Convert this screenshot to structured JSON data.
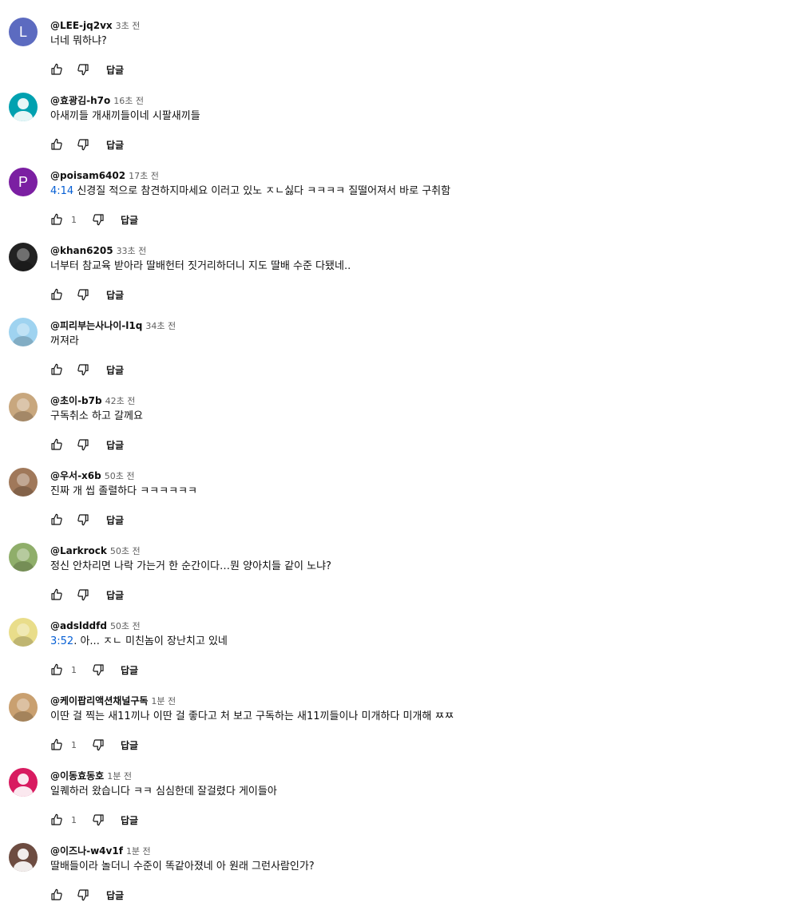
{
  "reply_label": "답글",
  "comments": [
    {
      "author": "@LEE-jq2vx",
      "time": "3초 전",
      "timestamp": "",
      "text": "너네 뭐하냐?",
      "likes": "",
      "avatar": {
        "type": "letter",
        "letter": "L",
        "color": "#5c6bc0"
      }
    },
    {
      "author": "@효광김-h7o",
      "time": "16초 전",
      "timestamp": "",
      "text": "아새끼들 개새끼들이네 시팔새끼들",
      "likes": "",
      "avatar": {
        "type": "person",
        "color": "#00a1b0"
      }
    },
    {
      "author": "@poisam6402",
      "time": "17초 전",
      "timestamp": "4:14",
      "text": " 신경질 적으로 참견하지마세요 이러고 있노 ㅈㄴ싫다 ㅋㅋㅋㅋ 질떨어져서 바로 구취함",
      "likes": "1",
      "avatar": {
        "type": "letter",
        "letter": "P",
        "color": "#7b1fa2"
      }
    },
    {
      "author": "@khan6205",
      "time": "33초 전",
      "timestamp": "",
      "text": "너부터 참교육 받아라 딸배헌터 짓거리하더니 지도 딸배 수준 다됐네..",
      "likes": "",
      "avatar": {
        "type": "photo",
        "color": "#222222"
      }
    },
    {
      "author": "@피리부는사나이-l1q",
      "time": "34초 전",
      "timestamp": "",
      "text": "꺼져라",
      "likes": "",
      "avatar": {
        "type": "photo",
        "color": "#9fd3f0"
      }
    },
    {
      "author": "@초이-b7b",
      "time": "42초 전",
      "timestamp": "",
      "text": "구독취소 하고 갈께요",
      "likes": "",
      "avatar": {
        "type": "photo",
        "color": "#c8a77e"
      }
    },
    {
      "author": "@우서-x6b",
      "time": "50초 전",
      "timestamp": "",
      "text": "진짜 개 씹 졸렬하다 ㅋㅋㅋㅋㅋㅋ",
      "likes": "",
      "avatar": {
        "type": "photo",
        "color": "#a0785a"
      }
    },
    {
      "author": "@Larkrock",
      "time": "50초 전",
      "timestamp": "",
      "text": "정신 안차리면 나락 가는거 한 순간이다…뭔 양아치들 같이 노냐?",
      "likes": "",
      "avatar": {
        "type": "photo",
        "color": "#8fae6a"
      }
    },
    {
      "author": "@adslddfd",
      "time": "50초 전",
      "timestamp": "3:52",
      "text": ". 아... ㅈㄴ 미친놈이 장난치고 있네",
      "likes": "1",
      "avatar": {
        "type": "photo",
        "color": "#e9dd8a"
      }
    },
    {
      "author": "@케이팝리액션채널구독",
      "time": "1분 전",
      "timestamp": "",
      "text": "이딴 걸 찍는 새11끼나 이딴 걸 좋다고 처 보고 구독하는 새11끼들이나 미개하다 미개해 ㅉㅉ",
      "likes": "1",
      "avatar": {
        "type": "photo",
        "color": "#c9a070"
      }
    },
    {
      "author": "@이동효동호",
      "time": "1분 전",
      "timestamp": "",
      "text": "일퀘하러 왔습니다 ㅋㅋ 심심한데 잘걸렸다 게이들아",
      "likes": "1",
      "avatar": {
        "type": "person",
        "color": "#d81b60"
      }
    },
    {
      "author": "@이즈나-w4v1f",
      "time": "1분 전",
      "timestamp": "",
      "text": "딸배들이라 놀더니 수준이 똑같아졌네   아 원래 그런사람인가?",
      "likes": "",
      "avatar": {
        "type": "person",
        "color": "#6d4c41"
      }
    }
  ]
}
